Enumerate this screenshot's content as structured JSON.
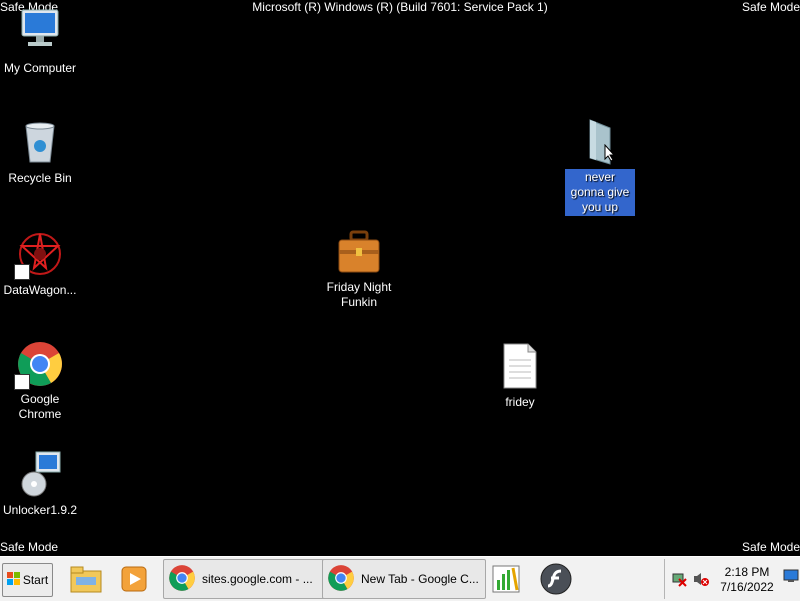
{
  "overlay": {
    "top_left": "Safe Mode",
    "top_center": "Microsoft (R) Windows (R) (Build 7601: Service Pack 1)",
    "top_right": "Safe Mode",
    "bottom_left": "Safe Mode",
    "bottom_right": "Safe Mode"
  },
  "desktop": {
    "icons": [
      {
        "label": "My Computer"
      },
      {
        "label": "Recycle Bin"
      },
      {
        "label": "DataWagon..."
      },
      {
        "label": "Google Chrome"
      },
      {
        "label": "Unlocker1.9.2"
      },
      {
        "label": "Friday Night Funkin"
      },
      {
        "label": "never gonna give you up"
      },
      {
        "label": "fridey"
      }
    ]
  },
  "taskbar": {
    "start_label": "Start",
    "tasks": [
      {
        "label": "sites.google.com - ..."
      },
      {
        "label": "New Tab - Google C..."
      }
    ],
    "clock": {
      "time": "2:18 PM",
      "date": "7/16/2022"
    }
  },
  "colors": {
    "desktop_bg": "#000000",
    "selection": "#3366cc",
    "taskbar_bg": "#f2f2f2"
  }
}
